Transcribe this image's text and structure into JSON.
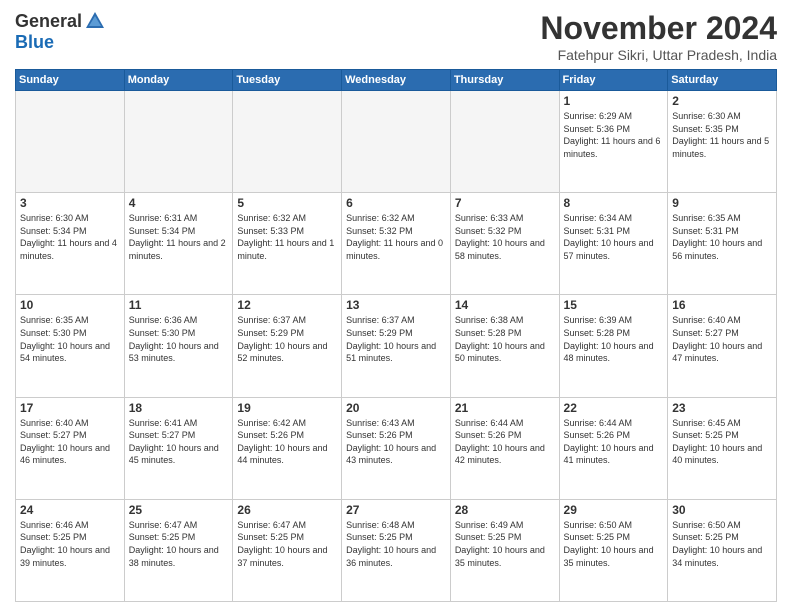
{
  "header": {
    "logo_general": "General",
    "logo_blue": "Blue",
    "title": "November 2024",
    "location": "Fatehpur Sikri, Uttar Pradesh, India"
  },
  "calendar": {
    "days_of_week": [
      "Sunday",
      "Monday",
      "Tuesday",
      "Wednesday",
      "Thursday",
      "Friday",
      "Saturday"
    ],
    "weeks": [
      [
        {
          "day": "",
          "info": "",
          "empty": true
        },
        {
          "day": "",
          "info": "",
          "empty": true
        },
        {
          "day": "",
          "info": "",
          "empty": true
        },
        {
          "day": "",
          "info": "",
          "empty": true
        },
        {
          "day": "",
          "info": "",
          "empty": true
        },
        {
          "day": "1",
          "info": "Sunrise: 6:29 AM\nSunset: 5:36 PM\nDaylight: 11 hours and 6 minutes."
        },
        {
          "day": "2",
          "info": "Sunrise: 6:30 AM\nSunset: 5:35 PM\nDaylight: 11 hours and 5 minutes."
        }
      ],
      [
        {
          "day": "3",
          "info": "Sunrise: 6:30 AM\nSunset: 5:34 PM\nDaylight: 11 hours and 4 minutes."
        },
        {
          "day": "4",
          "info": "Sunrise: 6:31 AM\nSunset: 5:34 PM\nDaylight: 11 hours and 2 minutes."
        },
        {
          "day": "5",
          "info": "Sunrise: 6:32 AM\nSunset: 5:33 PM\nDaylight: 11 hours and 1 minute."
        },
        {
          "day": "6",
          "info": "Sunrise: 6:32 AM\nSunset: 5:32 PM\nDaylight: 11 hours and 0 minutes."
        },
        {
          "day": "7",
          "info": "Sunrise: 6:33 AM\nSunset: 5:32 PM\nDaylight: 10 hours and 58 minutes."
        },
        {
          "day": "8",
          "info": "Sunrise: 6:34 AM\nSunset: 5:31 PM\nDaylight: 10 hours and 57 minutes."
        },
        {
          "day": "9",
          "info": "Sunrise: 6:35 AM\nSunset: 5:31 PM\nDaylight: 10 hours and 56 minutes."
        }
      ],
      [
        {
          "day": "10",
          "info": "Sunrise: 6:35 AM\nSunset: 5:30 PM\nDaylight: 10 hours and 54 minutes."
        },
        {
          "day": "11",
          "info": "Sunrise: 6:36 AM\nSunset: 5:30 PM\nDaylight: 10 hours and 53 minutes."
        },
        {
          "day": "12",
          "info": "Sunrise: 6:37 AM\nSunset: 5:29 PM\nDaylight: 10 hours and 52 minutes."
        },
        {
          "day": "13",
          "info": "Sunrise: 6:37 AM\nSunset: 5:29 PM\nDaylight: 10 hours and 51 minutes."
        },
        {
          "day": "14",
          "info": "Sunrise: 6:38 AM\nSunset: 5:28 PM\nDaylight: 10 hours and 50 minutes."
        },
        {
          "day": "15",
          "info": "Sunrise: 6:39 AM\nSunset: 5:28 PM\nDaylight: 10 hours and 48 minutes."
        },
        {
          "day": "16",
          "info": "Sunrise: 6:40 AM\nSunset: 5:27 PM\nDaylight: 10 hours and 47 minutes."
        }
      ],
      [
        {
          "day": "17",
          "info": "Sunrise: 6:40 AM\nSunset: 5:27 PM\nDaylight: 10 hours and 46 minutes."
        },
        {
          "day": "18",
          "info": "Sunrise: 6:41 AM\nSunset: 5:27 PM\nDaylight: 10 hours and 45 minutes."
        },
        {
          "day": "19",
          "info": "Sunrise: 6:42 AM\nSunset: 5:26 PM\nDaylight: 10 hours and 44 minutes."
        },
        {
          "day": "20",
          "info": "Sunrise: 6:43 AM\nSunset: 5:26 PM\nDaylight: 10 hours and 43 minutes."
        },
        {
          "day": "21",
          "info": "Sunrise: 6:44 AM\nSunset: 5:26 PM\nDaylight: 10 hours and 42 minutes."
        },
        {
          "day": "22",
          "info": "Sunrise: 6:44 AM\nSunset: 5:26 PM\nDaylight: 10 hours and 41 minutes."
        },
        {
          "day": "23",
          "info": "Sunrise: 6:45 AM\nSunset: 5:25 PM\nDaylight: 10 hours and 40 minutes."
        }
      ],
      [
        {
          "day": "24",
          "info": "Sunrise: 6:46 AM\nSunset: 5:25 PM\nDaylight: 10 hours and 39 minutes."
        },
        {
          "day": "25",
          "info": "Sunrise: 6:47 AM\nSunset: 5:25 PM\nDaylight: 10 hours and 38 minutes."
        },
        {
          "day": "26",
          "info": "Sunrise: 6:47 AM\nSunset: 5:25 PM\nDaylight: 10 hours and 37 minutes."
        },
        {
          "day": "27",
          "info": "Sunrise: 6:48 AM\nSunset: 5:25 PM\nDaylight: 10 hours and 36 minutes."
        },
        {
          "day": "28",
          "info": "Sunrise: 6:49 AM\nSunset: 5:25 PM\nDaylight: 10 hours and 35 minutes."
        },
        {
          "day": "29",
          "info": "Sunrise: 6:50 AM\nSunset: 5:25 PM\nDaylight: 10 hours and 35 minutes."
        },
        {
          "day": "30",
          "info": "Sunrise: 6:50 AM\nSunset: 5:25 PM\nDaylight: 10 hours and 34 minutes."
        }
      ]
    ]
  }
}
